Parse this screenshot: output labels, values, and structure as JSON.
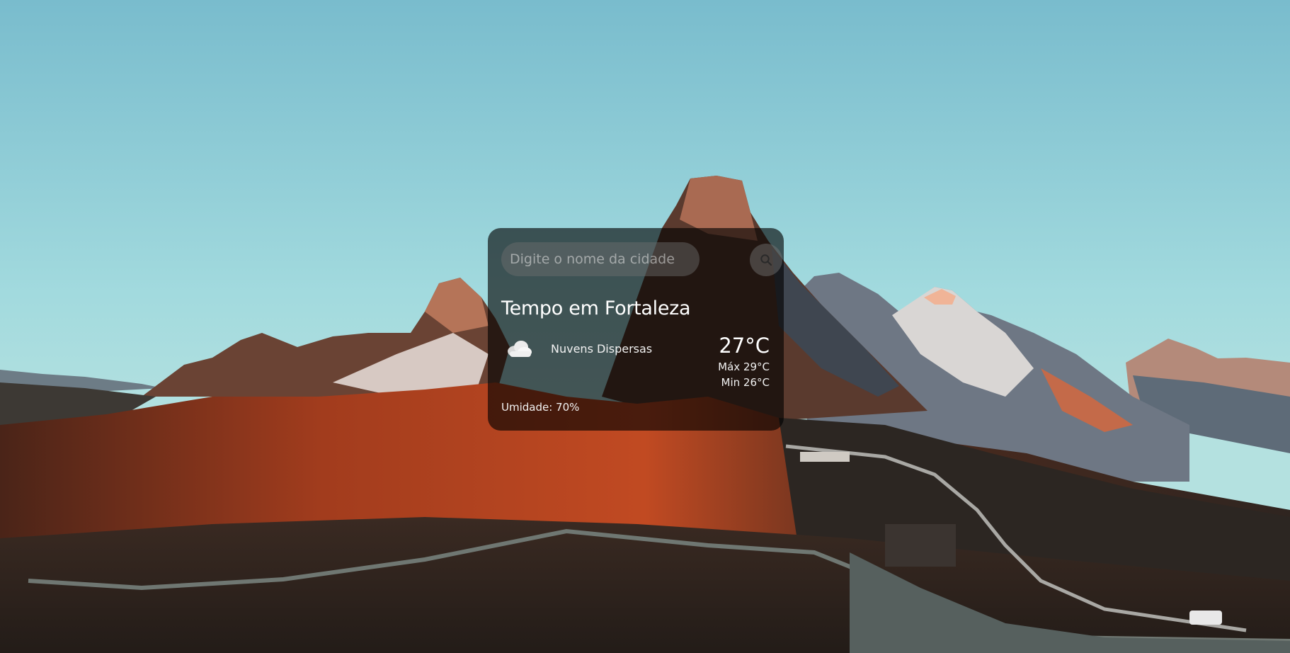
{
  "search": {
    "placeholder": "Digite o nome da cidade",
    "button_icon": "search-icon"
  },
  "weather": {
    "title": "Tempo em Fortaleza",
    "icon": "cloud-icon",
    "description": "Nuvens Dispersas",
    "temperature": "27°C",
    "max": "Máx 29°C",
    "min": "Min 26°C",
    "humidity": "Umidade: 70%"
  },
  "colors": {
    "sky_top": "#7fc0cf",
    "sky_bottom": "#a9dde0",
    "card_background": "rgba(0,0,0,0.62)",
    "text": "#ffffff"
  }
}
